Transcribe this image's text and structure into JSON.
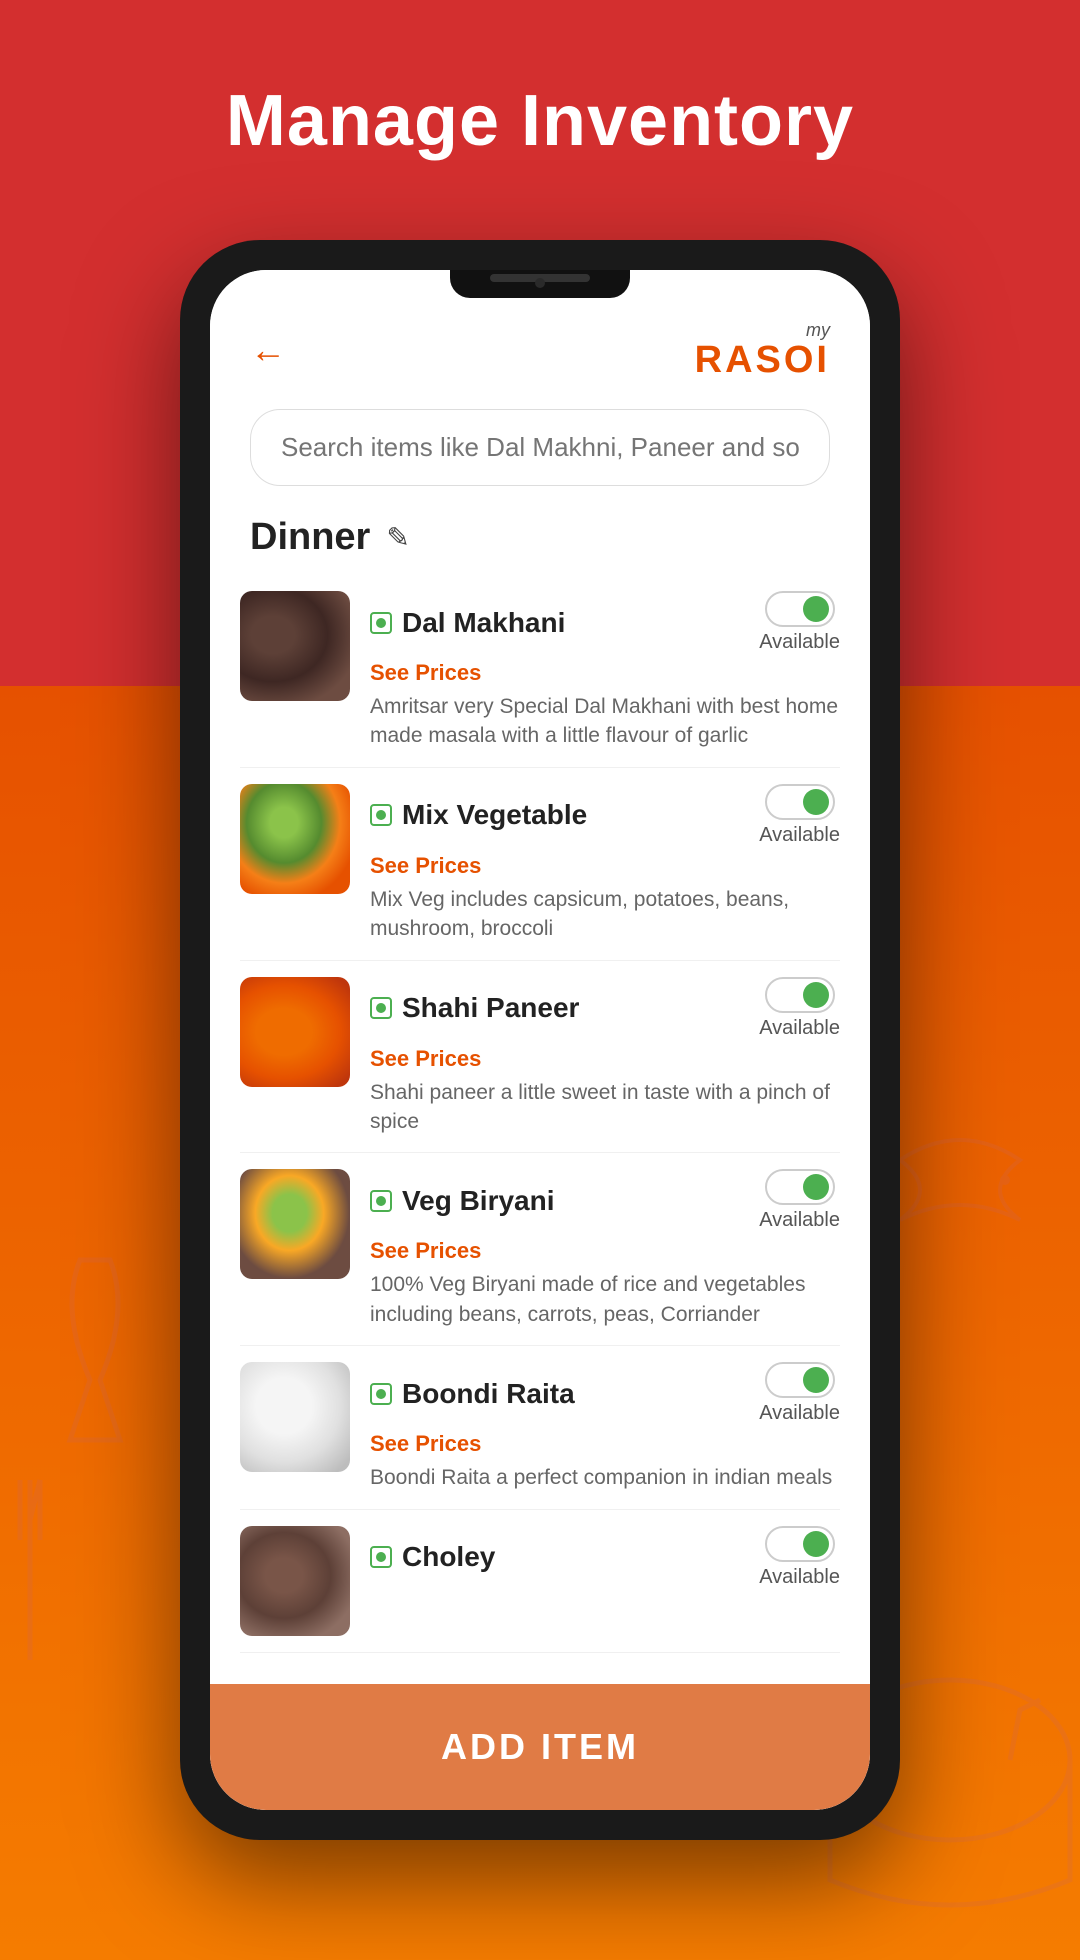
{
  "page": {
    "title": "Manage Inventory",
    "background_top": "#d32f2f",
    "background_bottom": "#f57c00"
  },
  "header": {
    "back_label": "←",
    "logo_my": "my",
    "logo_rasoi": "RASOI"
  },
  "search": {
    "placeholder": "Search items like Dal Makhni, Paneer and so on.."
  },
  "section": {
    "title": "Dinner",
    "edit_icon": "✎"
  },
  "menu_items": [
    {
      "id": 1,
      "name": "Dal Makhani",
      "image_class": "food-dal-makhani",
      "see_prices": "See Prices",
      "description": "Amritsar very Special Dal Makhani with best home made masala with a little flavour of garlic",
      "available": true,
      "toggle_label": "Available"
    },
    {
      "id": 2,
      "name": "Mix Vegetable",
      "image_class": "food-mix-vegetable",
      "see_prices": "See Prices",
      "description": "Mix Veg includes capsicum, potatoes, beans, mushroom, broccoli",
      "available": true,
      "toggle_label": "Available"
    },
    {
      "id": 3,
      "name": "Shahi Paneer",
      "image_class": "food-shahi-paneer",
      "see_prices": "See Prices",
      "description": "Shahi paneer a little sweet in taste with a pinch of spice",
      "available": true,
      "toggle_label": "Available"
    },
    {
      "id": 4,
      "name": "Veg Biryani",
      "image_class": "food-veg-biryani",
      "see_prices": "See Prices",
      "description": "100% Veg Biryani made of rice and vegetables including beans, carrots, peas, Corriander",
      "available": true,
      "toggle_label": "Available"
    },
    {
      "id": 5,
      "name": "Boondi Raita",
      "image_class": "food-boondi-raita",
      "see_prices": "See Prices",
      "description": "Boondi Raita a perfect companion in indian meals",
      "available": true,
      "toggle_label": "Available"
    },
    {
      "id": 6,
      "name": "Choley",
      "image_class": "food-choley",
      "see_prices": "",
      "description": "",
      "available": true,
      "toggle_label": "Available"
    }
  ],
  "add_button": {
    "label": "ADD ITEM"
  }
}
